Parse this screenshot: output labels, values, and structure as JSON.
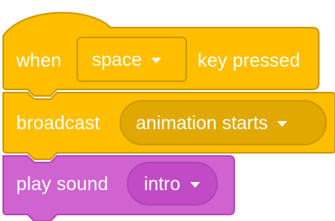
{
  "blocks": {
    "hat": {
      "prefix": "when",
      "key_value": "space",
      "suffix": "key pressed"
    },
    "broadcast": {
      "label": "broadcast",
      "message": "animation starts"
    },
    "sound": {
      "label": "play sound",
      "sound_name": "intro"
    }
  },
  "colors": {
    "events_fill": "#ffbf00",
    "events_border": "#cc9900",
    "sound_fill": "#cf63cf",
    "sound_border": "#bd42bd"
  },
  "icons": {
    "dropdown": "caret-down-icon"
  }
}
